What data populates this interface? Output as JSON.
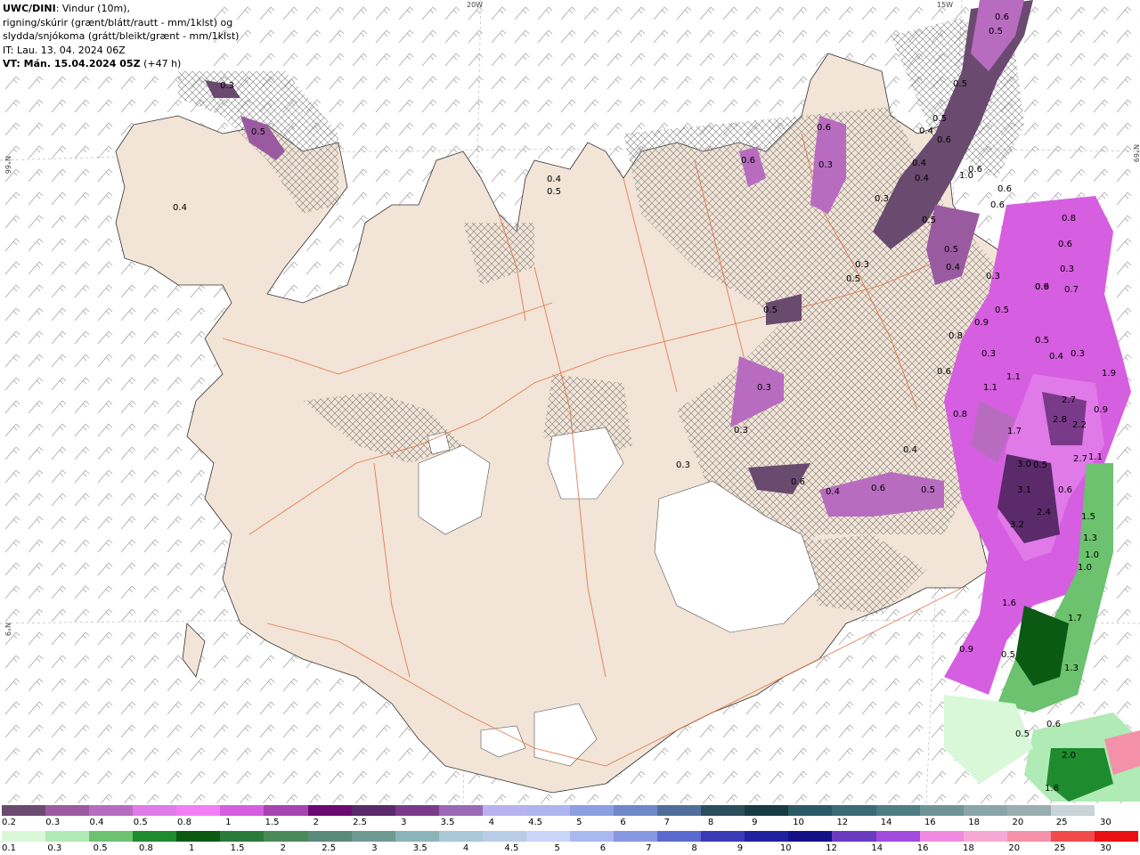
{
  "header": {
    "model": "UWC/DINI",
    "line1_rest": ": Vindur (10m),",
    "line2": "rigning/skúrir (grænt/blátt/rautt - mm/1klst) og",
    "line3": "slydda/snjókoma (grátt/bleikt/grænt - mm/1klst)",
    "line4": "IT: Lau. 13. 04. 2024 06Z",
    "line5_prefix": "VT: Mán. 15.04.2024 05Z",
    "line5_suffix": "(+47 h)"
  },
  "graticule": {
    "top_left": "20W",
    "top_right": "15W",
    "left_upper": "N°66",
    "left_lower": "N°9",
    "right_upper": "N°69"
  },
  "map_values": {
    "snow": [
      "0.3",
      "0.5",
      "0.4",
      "0.4",
      "0.5",
      "0.6",
      "0.3",
      "0.6",
      "0.6",
      "0.5",
      "0.5",
      "0.5",
      "0.4",
      "0.6",
      "1.0",
      "0.4",
      "0.6",
      "0.4",
      "0.3",
      "0.3",
      "0.5",
      "0.6",
      "0.6",
      "0.5",
      "0.5",
      "0.4",
      "0.3",
      "0.9",
      "0.8",
      "0.6",
      "0.3",
      "0.7",
      "0.6",
      "0.5",
      "0.9",
      "0.8",
      "0.6",
      "0.3",
      "0.5",
      "0.4",
      "0.3",
      "1.1",
      "1.1",
      "0.8",
      "1.7",
      "1.9",
      "2.7",
      "2.8",
      "2.2",
      "0.9",
      "2.7",
      "3.0",
      "3.1",
      "2.4",
      "1.1",
      "0.6",
      "3.2",
      "1.6",
      "0.9",
      "0.5",
      "0.3",
      "0.3",
      "0.6",
      "0.4",
      "0.6",
      "0.4",
      "0.5",
      "0.3",
      "0.5",
      "0.5"
    ],
    "rain": [
      "1.5",
      "1.3",
      "1.0",
      "1.0",
      "1.7",
      "1.3",
      "0.5",
      "0.6",
      "2.0",
      "1.8"
    ]
  },
  "legend": {
    "snow_labels": [
      "0.2",
      "0.3",
      "0.4",
      "0.5",
      "0.8",
      "1",
      "1.5",
      "2",
      "2.5",
      "3",
      "3.5",
      "4",
      "4.5",
      "5",
      "6",
      "7",
      "8",
      "9",
      "10",
      "12",
      "14",
      "16",
      "18",
      "20",
      "25",
      "30"
    ],
    "rain_labels": [
      "0.1",
      "0.3",
      "0.5",
      "0.8",
      "1",
      "1.5",
      "2",
      "2.5",
      "3",
      "3.5",
      "4",
      "4.5",
      "5",
      "6",
      "7",
      "8",
      "9",
      "10",
      "12",
      "14",
      "16",
      "18",
      "20",
      "25",
      "30"
    ],
    "snow_colors": [
      "#6b4a70",
      "#9a5aa0",
      "#b86cc0",
      "#e07ae8",
      "#f27ef6",
      "#d65ee0",
      "#a645b0",
      "#6b0b72",
      "#5a2a6b",
      "#7a3a8a",
      "#9a6ab8",
      "#b8b2f2",
      "#aeb4f0",
      "#8aa0e0",
      "#6e88c8",
      "#4f6f9a",
      "#2a4f5a",
      "#183a44",
      "#2a5a66",
      "#3a6a72",
      "#4e7e84",
      "#6e9496",
      "#8aa6a8",
      "#9aaeb2",
      "#c8d4d8",
      "#ffffff"
    ],
    "rain_colors": [
      "#d8f8d8",
      "#b0eab4",
      "#6cc26e",
      "#1e8b2e",
      "#0a5a14",
      "#2a7a3a",
      "#4a8a5a",
      "#5a8a7a",
      "#6e9a92",
      "#8ab4ba",
      "#a8c8d8",
      "#b8cce8",
      "#c8d4f8",
      "#aab8f0",
      "#8898e0",
      "#5a6ad0",
      "#3a3ab8",
      "#2020a0",
      "#14108a",
      "#6a3ac0",
      "#a24ae0",
      "#f08ae0",
      "#f6a8d4",
      "#f490a8",
      "#f04a4a",
      "#e81010"
    ]
  }
}
